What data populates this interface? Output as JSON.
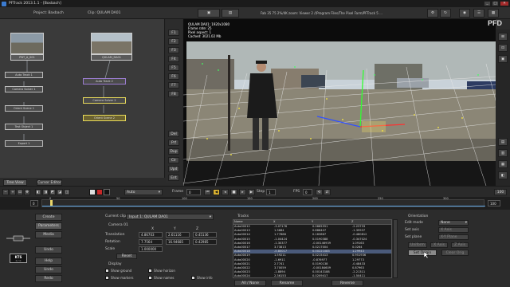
{
  "window": {
    "title": "PFTrack 2013.1.1 - [Boxbach]",
    "controls": [
      "_",
      "□",
      "✕"
    ],
    "logo": "PFD"
  },
  "header": {
    "project": "Project: Baxbach",
    "clip": "Clip: QULAM DA01",
    "status": "Fab 35 75 2%/4K zoom: Viewer 2 /(Program Files/The Pixel Farm/PFTrack 5 ..."
  },
  "left_sidebar": {
    "buttons_top": [
      "F1",
      "F2",
      "F3",
      "F4",
      "F5",
      "F6",
      "F7",
      "F8"
    ],
    "buttons_bottom": [
      "Del",
      "Prf",
      "Dup",
      "Clr",
      "Upd",
      "Ent"
    ]
  },
  "node_tree": {
    "nodes": [
      {
        "id": "n1",
        "label": "PNT_A_001",
        "thumb": true
      },
      {
        "id": "n2",
        "label": "QULAM_DA01",
        "thumb": true
      },
      {
        "id": "n3",
        "label": "Auto Track 1"
      },
      {
        "id": "n4",
        "label": "Camera Solver 1"
      },
      {
        "id": "n5",
        "label": "Orient Scene 1"
      },
      {
        "id": "n6",
        "label": "Test Object 1"
      },
      {
        "id": "n7",
        "label": "Export 1"
      },
      {
        "id": "n8",
        "label": "Auto Track 2"
      },
      {
        "id": "n9",
        "label": "Camera Solver 2"
      },
      {
        "id": "n10",
        "label": "Orient Scene 2"
      }
    ],
    "tabs": [
      "Tree View",
      "Cursor Editor"
    ]
  },
  "viewer": {
    "overlay_lines": [
      "QULAM DA01: 1920x1080",
      "Frame rate: 25",
      "Pixel aspect: 1",
      "Cached: 3021.02 Mb"
    ],
    "right_buttons": [
      "⊞",
      "⊡",
      "▣",
      "▤",
      "▥",
      "▦",
      "◧",
      "◨",
      "◩",
      "◪",
      "◫"
    ]
  },
  "transport": {
    "frame_label": "Frame",
    "frame_value": "0",
    "step_label": "Step",
    "step_value": "1",
    "fps_label": "FPS",
    "fps_value": "0",
    "auto_label": "Auto"
  },
  "timeline": {
    "start": "0",
    "end": "100",
    "current": "0",
    "ticks": [
      "0",
      "50",
      "100",
      "150",
      "200",
      "250",
      "300"
    ]
  },
  "bottom_left": {
    "buttons": [
      "Create",
      "Parameters",
      "Media",
      "Undo",
      "Help",
      "Undo",
      "Redo"
    ],
    "badge_top": "KTS",
    "badge_bottom": "0 / 0"
  },
  "camera_panel": {
    "current_clip_label": "Current clip:",
    "current_clip_value": "Input 1: QULAM DA01",
    "camera_label": "Camera 01",
    "columns": [
      "X",
      "Y",
      "Z"
    ],
    "rows": [
      {
        "label": "Translation",
        "values": [
          "4.86703",
          "2.61116",
          "0.45136"
        ]
      },
      {
        "label": "Rotation",
        "values": [
          "7.7564",
          "16.94685",
          "0.42985"
        ]
      },
      {
        "label": "Scale",
        "values": [
          "1.000000",
          "",
          ""
        ]
      }
    ],
    "reset_label": "Reset",
    "display_label": "Display",
    "checkboxes": [
      {
        "label": "Show ground",
        "checked": true
      },
      {
        "label": "Show horizon",
        "checked": true
      },
      {
        "label": "Show markers",
        "checked": true
      },
      {
        "label": "Show names",
        "checked": true
      },
      {
        "label": "Show info",
        "checked": true
      }
    ]
  },
  "tracks_panel": {
    "title": "Tracks",
    "columns": [
      "Name",
      "X",
      "Y",
      "Z"
    ],
    "rows": [
      [
        "Auto00012",
        "-3.07176",
        "0.0665551",
        "-2.23733"
      ],
      [
        "Auto00013",
        "1.3684",
        "0.886407",
        "-1.39937"
      ],
      [
        "Auto00014",
        "1.77888",
        "0.163667",
        "-0.480812"
      ],
      [
        "Auto00015",
        "-1.04424",
        "0.0190388",
        "-0.347024"
      ],
      [
        "Auto00016",
        "-1.30377",
        "-0.00146939",
        "1.09163"
      ],
      [
        "Auto00017",
        "3.73813",
        "0.0217004",
        "0.0264"
      ],
      [
        "Auto00018",
        "-5.80017",
        "0.00221083",
        "1.29943"
      ],
      [
        "Auto00019",
        "1.59211",
        "0.0215413",
        "0.951936"
      ],
      [
        "Auto00020",
        "-1.6911",
        "-0.876977",
        "1.29773"
      ],
      [
        "Auto00021",
        "2.7741",
        "0.0190138",
        "-0.48433"
      ],
      [
        "Auto00022",
        "3.70059",
        "-0.00184609",
        "0.87963"
      ],
      [
        "Auto00023",
        "-1.8894",
        "0.00143188",
        "-2.21311"
      ],
      [
        "Auto00024",
        "2.36153",
        "0.0209417",
        "-1.50411"
      ]
    ],
    "footer_left": "All / None",
    "footer_mid": "Rename",
    "footer_right": "Reverse"
  },
  "orientation_panel": {
    "title": "Orientation",
    "rows": [
      {
        "label": "Edit mode",
        "value": "None"
      },
      {
        "label": "Set axis",
        "value": "X Axis"
      },
      {
        "label": "Set plane",
        "value": "X-Y Plane"
      }
    ],
    "small_buttons": [
      "Uniform",
      "X Axis",
      "Z Axis"
    ],
    "set_origin": "Set Origin",
    "clear_origin": "Clear Orig"
  },
  "colors": {
    "grid": "#e8e8e8",
    "axis_x": "#ff3030",
    "axis_y": "#30ff30",
    "axis_z": "#3050ff",
    "node_selected": "#e7d95a",
    "node_active": "#9a7cd0",
    "timeline_marker": "#e9d56a"
  }
}
